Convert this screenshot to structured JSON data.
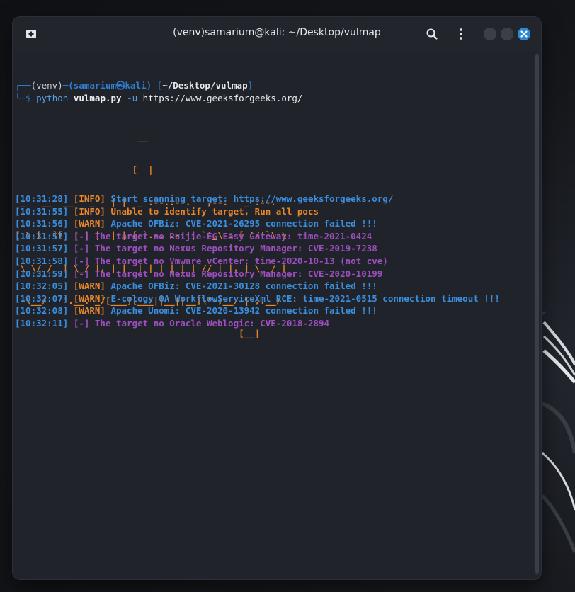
{
  "window": {
    "title": "(venv)samarium@kali: ~/Desktop/vulmap"
  },
  "icons": {
    "new_tab": "new-tab-icon",
    "search": "search-icon",
    "menu": "kebab-menu-icon",
    "close": "close-icon"
  },
  "colors": {
    "accent_blue": "#3a8fe0",
    "orange": "#e8862a",
    "purple": "#9d4fc0",
    "terminal_bg": "#20232a",
    "close_button": "#2b8ad8"
  },
  "prompt": {
    "frame_open": "┌──",
    "venv": "(venv)",
    "dash": "─",
    "user_host": "(samarium㉿kali)",
    "bracket_open": "-[",
    "path": "~/Desktop/vulmap",
    "bracket_close": "]",
    "frame_close": "└─",
    "dollar": "$ ",
    "command": "python",
    "script": "vulmap.py",
    "flag": "-u",
    "url": "https://www.geeksforgeeks.org/"
  },
  "banner": [
    "                       __",
    "                      [  |",
    " _   __  __   _   | |  _ .--..--.   ,--.   _ .--.",
    "[ \\ [  ][  | | |  | | [ `.-. .-. | `'_\\ : [ '/'`\\ \\",
    " \\ \\/ /  | \\_/ |, | |  | | | | | | // | |, | \\__/ |",
    "  \\__/   '.__.'_/[___][___||__||__]\\'-;__/ | ;.__/",
    "                                          [__|"
  ],
  "log": [
    {
      "time": "[10:31:28]",
      "tag": "[INFO]",
      "msg": "Start scanning target: https://www.geeksforgeeks.org/",
      "tag_color": "orange",
      "msg_color": "blue"
    },
    {
      "time": "[10:31:55]",
      "tag": "[INFO]",
      "msg": "Unable to identify target, Run all pocs",
      "tag_color": "orange",
      "msg_color": "orange"
    },
    {
      "time": "[10:31:56]",
      "tag": "[WARN]",
      "msg": "Apache OFBiz: CVE-2021-26295 connection failed !!!",
      "tag_color": "orange",
      "msg_color": "blue"
    },
    {
      "time": "[10:31:57]",
      "tag": "[-]",
      "msg": "The target no Ruijie-EG Easy Gateway: time-2021-0424",
      "tag_color": "purple",
      "msg_color": "purple"
    },
    {
      "time": "[10:31:57]",
      "tag": "[-]",
      "msg": "The target no Nexus Repository Manager: CVE-2019-7238",
      "tag_color": "purple",
      "msg_color": "purple"
    },
    {
      "time": "[10:31:58]",
      "tag": "[-]",
      "msg": "The target no Vmware vCenter: time-2020-10-13 (not cve)",
      "tag_color": "purple",
      "msg_color": "purple"
    },
    {
      "time": "[10:31:59]",
      "tag": "[-]",
      "msg": "The target no Nexus Repository Manager: CVE-2020-10199",
      "tag_color": "purple",
      "msg_color": "purple"
    },
    {
      "time": "[10:32:05]",
      "tag": "[WARN]",
      "msg": "Apache OFBiz: CVE-2021-30128 connection failed !!!",
      "tag_color": "orange",
      "msg_color": "blue"
    },
    {
      "time": "[10:32:07]",
      "tag": "[WARN]",
      "msg": "E-cology OA WorkflowServiceXml RCE: time-2021-0515 connection timeout !!!",
      "tag_color": "orange",
      "msg_color": "blue"
    },
    {
      "time": "[10:32:08]",
      "tag": "[WARN]",
      "msg": "Apache Unomi: CVE-2020-13942 connection failed !!!",
      "tag_color": "orange",
      "msg_color": "blue"
    },
    {
      "time": "[10:32:11]",
      "tag": "[-]",
      "msg": "The target no Oracle Weblogic: CVE-2018-2894",
      "tag_color": "purple",
      "msg_color": "purple"
    }
  ]
}
